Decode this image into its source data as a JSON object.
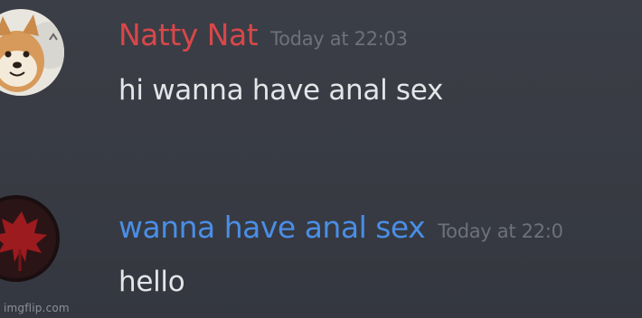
{
  "messages": [
    {
      "username": "Natty Nat",
      "username_color": "#d9474a",
      "timestamp": "Today at 22:03",
      "content": "hi wanna have anal sex",
      "avatar_icon": "shiba-dog-avatar"
    },
    {
      "username": "wanna have anal sex",
      "username_color": "#4a8ee6",
      "timestamp": "Today at 22:0",
      "content": "hello",
      "avatar_icon": "red-maple-leaf-avatar"
    }
  ],
  "watermark": "imgflip.com",
  "colors": {
    "background": "#3a3d45",
    "text": "#e4e5e8",
    "timestamp": "#6e717b"
  }
}
